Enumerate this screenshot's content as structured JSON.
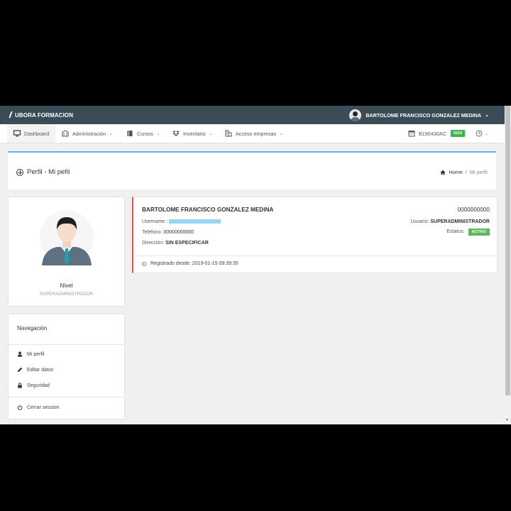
{
  "app": {
    "brand": "UBORA FORMACION"
  },
  "user_menu": {
    "name": "BARTOLOME FRANCISCO GONZALEZ MEDINA"
  },
  "nav": {
    "items": [
      {
        "label": "Dashboard",
        "icon": "monitor-icon"
      },
      {
        "label": "Administración",
        "icon": "building-icon"
      },
      {
        "label": "Cursos",
        "icon": "book-icon"
      },
      {
        "label": "Inventario",
        "icon": "dropbox-icon"
      },
      {
        "label": "Acceso empresas",
        "icon": "office-icon"
      }
    ],
    "code": "B190430AC",
    "year_badge": "2019"
  },
  "page": {
    "title": "Perfil - Mi pefil",
    "breadcrumb": {
      "home": "Home",
      "separator": "/",
      "current": "Mi perfil"
    }
  },
  "profile": {
    "level_label": "Nivel",
    "level_value": "SUPERADMINISTRADOR"
  },
  "side_nav": {
    "title": "Navegación",
    "items": [
      {
        "label": "Mi perfil",
        "icon": "user-icon"
      },
      {
        "label": "Editar datos",
        "icon": "pencil-icon"
      },
      {
        "label": "Seguridad",
        "icon": "lock-icon"
      }
    ],
    "logout": {
      "label": "Cerrar session",
      "icon": "power-icon"
    }
  },
  "info": {
    "name": "BARTOLOME FRANCISCO GONZALEZ MEDINA",
    "id_number": "0000000000",
    "username_label": "Username :",
    "phone_label": "Teléfono:",
    "phone_value": "00000000000",
    "address_label": "Dirección:",
    "address_value": "SIN ESPECIFICAR",
    "usuario_label": "Usuario:",
    "usuario_value": "SUPERADMINISTRADOR",
    "status_label": "Estatus:",
    "status_value": "ACTIVO",
    "registered_label": "Registrado desde:",
    "registered_value": "2019-01-15 09:39:35"
  },
  "colors": {
    "topbar": "#3c4c56",
    "accent": "#5ab4e6",
    "status_active": "#5cb85c",
    "registered_border": "#d9534f"
  }
}
